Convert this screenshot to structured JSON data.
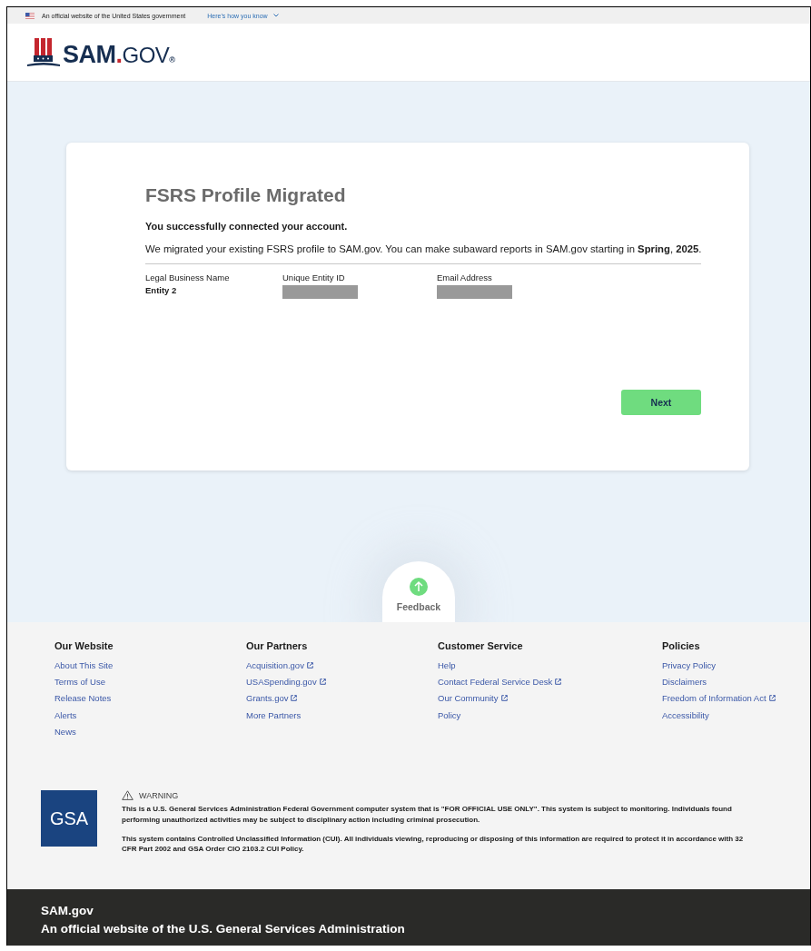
{
  "gov_banner": {
    "text": "An official website of the United States government",
    "link": "Here’s how you know"
  },
  "header": {
    "logo_main": "SAM",
    "logo_dot": ".",
    "logo_suffix": "GOV",
    "logo_mark": "®"
  },
  "card": {
    "title": "FSRS Profile Migrated",
    "subtitle": "You successfully connected your account.",
    "message": "We migrated your existing FSRS profile to SAM.gov. You can make subaward reports in SAM.gov starting in **Spring**, **2025**.",
    "fields": [
      {
        "label": "Legal Business Name",
        "value": "Entity 2",
        "redacted": false
      },
      {
        "label": "Unique Entity ID",
        "redacted": true
      },
      {
        "label": "Email Address",
        "redacted": true
      }
    ],
    "button": "Next"
  },
  "feedback": {
    "label": "Feedback"
  },
  "footer": {
    "columns": [
      {
        "heading": "Our Website",
        "links": [
          {
            "label": "About This Site",
            "external": false
          },
          {
            "label": "Terms of Use",
            "external": false
          },
          {
            "label": "Release Notes",
            "external": false
          },
          {
            "label": "Alerts",
            "external": false
          },
          {
            "label": "News",
            "external": false
          }
        ]
      },
      {
        "heading": "Our Partners",
        "links": [
          {
            "label": "Acquisition.gov",
            "external": true
          },
          {
            "label": "USASpending.gov",
            "external": true
          },
          {
            "label": "Grants.gov",
            "external": true
          },
          {
            "label": "More Partners",
            "external": false
          }
        ]
      },
      {
        "heading": "Customer Service",
        "links": [
          {
            "label": "Help",
            "external": false
          },
          {
            "label": "Contact Federal Service Desk",
            "external": true
          },
          {
            "label": "Our Community",
            "external": true
          },
          {
            "label": "Policy",
            "external": false
          }
        ]
      },
      {
        "heading": "Policies",
        "links": [
          {
            "label": "Privacy Policy",
            "external": false
          },
          {
            "label": "Disclaimers",
            "external": false
          },
          {
            "label": "Freedom of Information Act",
            "external": true
          },
          {
            "label": "Accessibility",
            "external": false
          }
        ]
      }
    ],
    "logo": "GSA",
    "warning_title": "WARNING",
    "warning_paragraphs": [
      "This is a U.S. General Services Administration Federal Government computer system that is \"FOR OFFICIAL USE ONLY\". This system is subject to monitoring. Individuals found performing unauthorized activities may be subject to disciplinary action including criminal prosecution.",
      "This system contains Controlled Unclassified Information (CUI). All individuals viewing, reproducing or disposing of this information are required to protect it in accordance with 32 CFR Part 2002 and GSA Order CIO 2103.2 CUI Policy."
    ]
  },
  "bottom_bar": {
    "site": "SAM.gov",
    "tagline": "An official website of the U.S. General Services Administration"
  }
}
